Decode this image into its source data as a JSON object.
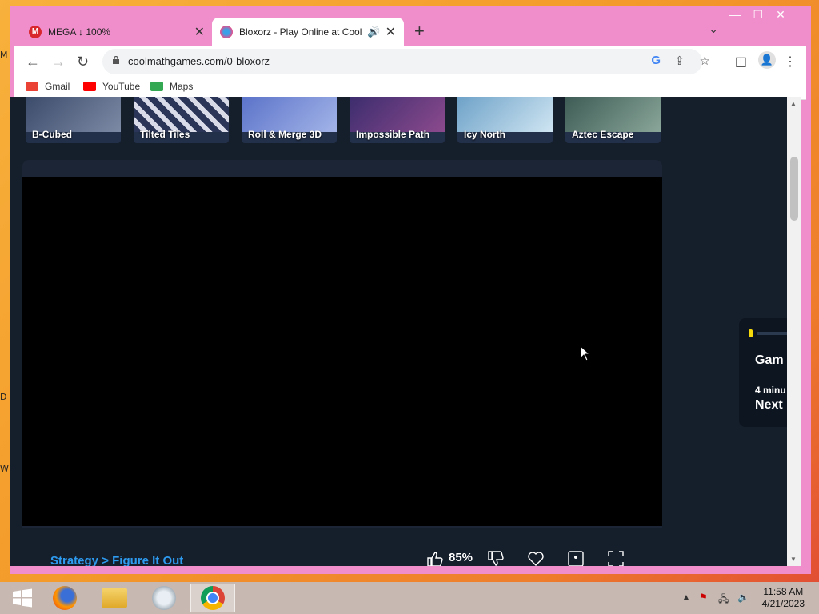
{
  "window": {
    "tabs": [
      {
        "title": "MEGA ↓ 100%",
        "favicon_color": "#d9272e"
      },
      {
        "title": "Bloxorz - Play Online at Cool",
        "favicon_color": "#ea4c89"
      }
    ]
  },
  "toolbar": {
    "url": "coolmathgames.com/0-bloxorz"
  },
  "bookmarks": [
    {
      "label": "Gmail",
      "color": "#ea4335"
    },
    {
      "label": "YouTube",
      "color": "#ff0000"
    },
    {
      "label": "Maps",
      "color": "#34a853"
    }
  ],
  "related_games": [
    {
      "label": "B-Cubed"
    },
    {
      "label": "Tilted Tiles"
    },
    {
      "label": "Roll & Merge 3D"
    },
    {
      "label": "Impossible Path"
    },
    {
      "label": "Icy North"
    },
    {
      "label": "Aztec Escape"
    }
  ],
  "game": {
    "breadcrumb": "Strategy > Figure It Out",
    "rating": "85%"
  },
  "side_card": {
    "title": "Gam",
    "time": "4 minu",
    "next": "Next"
  },
  "taskbar": {
    "time": "11:58 AM",
    "date": "4/21/2023"
  },
  "colors": {
    "window_frame": "#f08ecb",
    "page_bg": "#151e2b",
    "accent_link": "#2d9bf0"
  }
}
